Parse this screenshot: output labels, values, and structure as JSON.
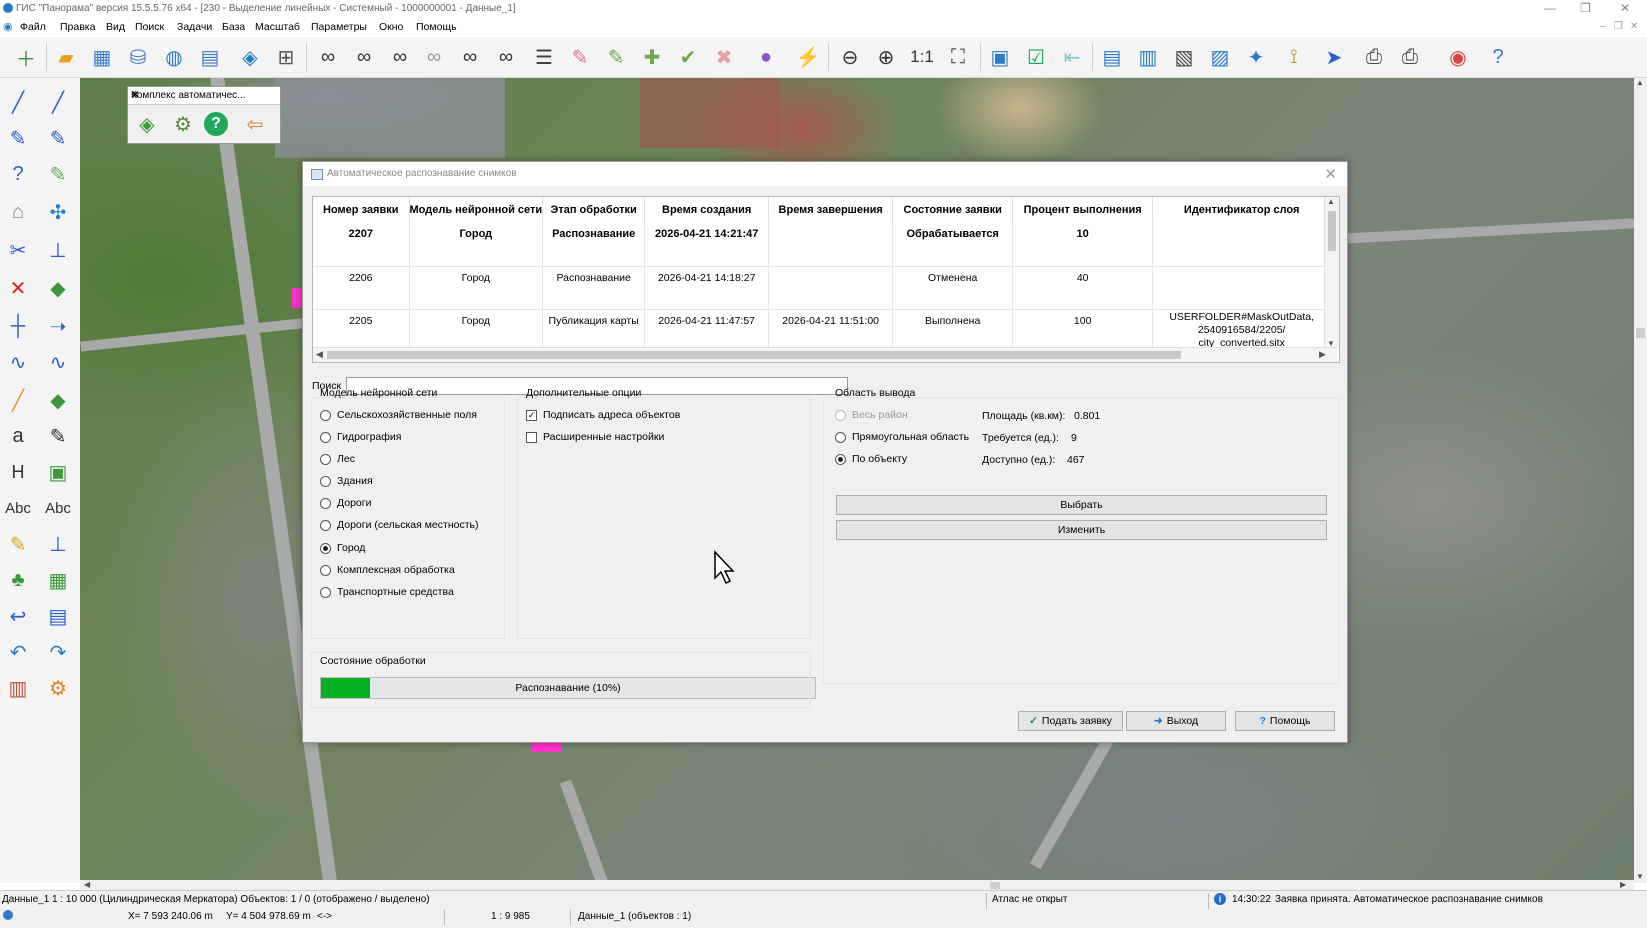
{
  "window": {
    "title": "ГИС \"Панорама\" версия 15.5.5.76 x64 - [230 - Выделение линейных - Системный - 1000000001 - Данные_1]"
  },
  "menu": [
    "Файл",
    "Правка",
    "Вид",
    "Поиск",
    "Задачи",
    "База",
    "Масштаб",
    "Параметры",
    "Окно",
    "Помощь"
  ],
  "toolbar": {
    "scale_label": "1:1"
  },
  "palette": {
    "title": "Комплекс автоматичес..."
  },
  "dialog": {
    "title": "Автоматическое распознавание снимков",
    "columns": [
      "Номер заявки",
      "Модель нейронной сети",
      "Этап обработки",
      "Время создания",
      "Время завершения",
      "Состояние заявки",
      "Процент выполнения",
      "Идентификатор слоя"
    ],
    "rows": [
      {
        "id": "2207",
        "model": "Город",
        "stage": "Распознавание",
        "created": "2026-04-21 14:21:47",
        "finished": "",
        "status": "Обрабатывается",
        "percent": "10",
        "layer": ""
      },
      {
        "id": "2206",
        "model": "Город",
        "stage": "Распознавание",
        "created": "2026-04-21 14:18:27",
        "finished": "",
        "status": "Отменена",
        "percent": "40",
        "layer": ""
      },
      {
        "id": "2205",
        "model": "Город",
        "stage": "Публикация карты",
        "created": "2026-04-21 11:47:57",
        "finished": "2026-04-21 11:51:00",
        "status": "Выполнена",
        "percent": "100",
        "layer": "USERFOLDER#MaskOutData, 2540916584/2205/ city_converted.sitx"
      }
    ],
    "search": {
      "label": "Поиск",
      "value": ""
    },
    "model_group": {
      "title": "Модель нейронной сети",
      "options": [
        "Сельскохозяйственные поля",
        "Гидрография",
        "Лес",
        "Здания",
        "Дороги",
        "Дороги (сельская местность)",
        "Город",
        "Комплексная обработка",
        "Транспортные средства"
      ],
      "selected": "Город"
    },
    "options_group": {
      "title": "Дополнительные опции",
      "sign_addresses": "Подписать адреса объектов",
      "sign_addresses_checked": true,
      "advanced": "Расширенные настройки",
      "advanced_checked": false
    },
    "output_group": {
      "title": "Область вывода",
      "whole_district": "Весь район",
      "rect_area": "Прямоугольная область",
      "by_object": "По объекту",
      "selected": "По объекту",
      "area_label": "Площадь (кв.км):",
      "area_value": "0.801",
      "required_label": "Требуется (ед.):",
      "required_value": "9",
      "available_label": "Доступно (ед.):",
      "available_value": "467",
      "choose_button": "Выбрать",
      "change_button": "Изменить"
    },
    "processing": {
      "title": "Состояние обработки",
      "progress_text": "Распознавание (10%)",
      "progress_percent": 10
    },
    "buttons": {
      "submit": "Подать заявку",
      "exit": "Выход",
      "help": "Помощь"
    }
  },
  "status": {
    "left": "Данные_1   1 : 10 000 (Цилиндрическая Меркатора) Объектов: 1 / 0 (отображено / выделено)",
    "atlas": "Атлас не открыт",
    "message_time": "14:30:22",
    "message": "Заявка принята. Автоматическое распознавание снимков",
    "coords_x": "X= 7 593 240.06 m",
    "coords_y": "Y= 4 504 978.69 m",
    "arrows": "<->",
    "scale": "1 : 9 985",
    "layer": "Данные_1   (объектов : 1)"
  },
  "colors": {
    "progress_fill": "#06b025",
    "dialog_bg": "#f0f0f0"
  }
}
